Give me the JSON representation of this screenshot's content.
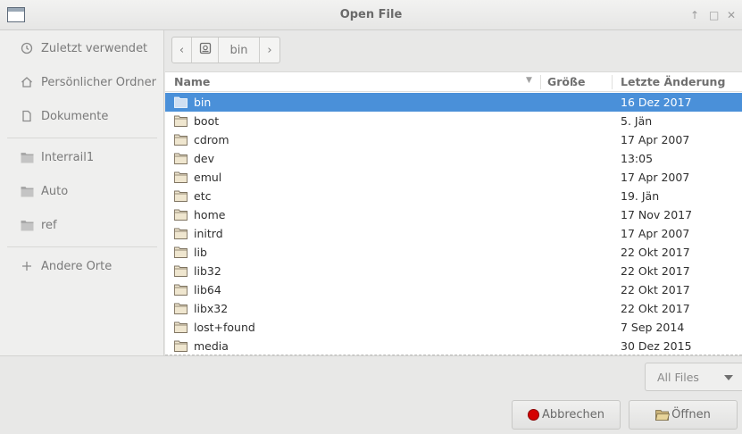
{
  "window": {
    "title": "Open File",
    "controls": {
      "keep_above": "↑",
      "maximize": "□",
      "close": "✕"
    }
  },
  "sidebar": {
    "items": [
      {
        "label": "Zuletzt verwendet",
        "icon": "clock-icon"
      },
      {
        "label": "Persönlicher Ordner",
        "icon": "home-icon"
      },
      {
        "label": "Dokumente",
        "icon": "document-icon"
      },
      {
        "label": "Interrail1",
        "icon": "folder-icon"
      },
      {
        "label": "Auto",
        "icon": "folder-icon"
      },
      {
        "label": "ref",
        "icon": "folder-icon"
      },
      {
        "label": "Andere Orte",
        "icon": "plus-icon"
      }
    ]
  },
  "pathbar": {
    "back": "‹",
    "root_icon": "drive-icon",
    "current": "bin",
    "forward": "›"
  },
  "columns": {
    "name": "Name",
    "size": "Größe",
    "modified": "Letzte Änderung"
  },
  "files": [
    {
      "name": "bin",
      "modified": "16 Dez 2017",
      "selected": true
    },
    {
      "name": "boot",
      "modified": "5. Jän"
    },
    {
      "name": "cdrom",
      "modified": "17 Apr 2007"
    },
    {
      "name": "dev",
      "modified": "13:05"
    },
    {
      "name": "emul",
      "modified": "17 Apr 2007"
    },
    {
      "name": "etc",
      "modified": "19. Jän"
    },
    {
      "name": "home",
      "modified": "17 Nov 2017"
    },
    {
      "name": "initrd",
      "modified": "17 Apr 2007"
    },
    {
      "name": "lib",
      "modified": "22 Okt 2017"
    },
    {
      "name": "lib32",
      "modified": "22 Okt 2017"
    },
    {
      "name": "lib64",
      "modified": "22 Okt 2017"
    },
    {
      "name": "libx32",
      "modified": "22 Okt 2017"
    },
    {
      "name": "lost+found",
      "modified": "7 Sep 2014"
    },
    {
      "name": "media",
      "modified": "30 Dez 2015"
    }
  ],
  "filter": {
    "selected": "All Files"
  },
  "buttons": {
    "cancel": "Abbrechen",
    "open": "Öffnen"
  },
  "colors": {
    "selection": "#4a90d9",
    "cancel_icon": "#d40000",
    "folder": "#e8dcc0"
  }
}
